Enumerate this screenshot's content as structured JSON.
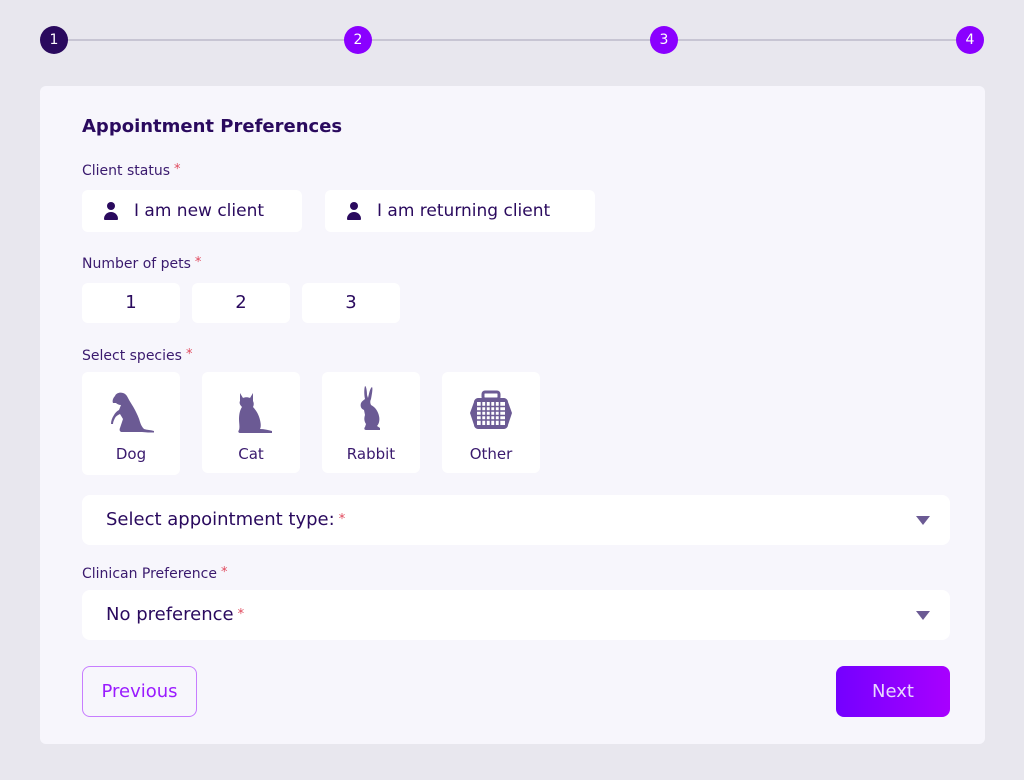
{
  "stepper": {
    "steps": [
      {
        "label": "1",
        "state": "active"
      },
      {
        "label": "2",
        "state": "upcoming"
      },
      {
        "label": "3",
        "state": "upcoming"
      },
      {
        "label": "4",
        "state": "upcoming"
      }
    ]
  },
  "form": {
    "title": "Appointment Preferences",
    "required_mark": "*",
    "client_status": {
      "label": "Client status",
      "options": [
        {
          "label": "I am new client",
          "icon": "person-icon"
        },
        {
          "label": "I am returning client",
          "icon": "person-icon"
        }
      ]
    },
    "number_of_pets": {
      "label": "Number of pets",
      "options": [
        "1",
        "2",
        "3"
      ]
    },
    "species": {
      "label": "Select species",
      "options": [
        {
          "label": "Dog",
          "icon": "dog-icon"
        },
        {
          "label": "Cat",
          "icon": "cat-icon"
        },
        {
          "label": "Rabbit",
          "icon": "rabbit-icon"
        },
        {
          "label": "Other",
          "icon": "pet-carrier-icon"
        }
      ]
    },
    "appointment_type": {
      "placeholder": "Select appointment type:"
    },
    "clinician_preference": {
      "label": "Clinican Preference",
      "value": "No preference"
    }
  },
  "actions": {
    "previous_label": "Previous",
    "next_label": "Next"
  },
  "colors": {
    "accent": "#8a00ff",
    "primary_text": "#2a0a5e",
    "icon": "#6b5a94",
    "required": "#e0485c"
  }
}
